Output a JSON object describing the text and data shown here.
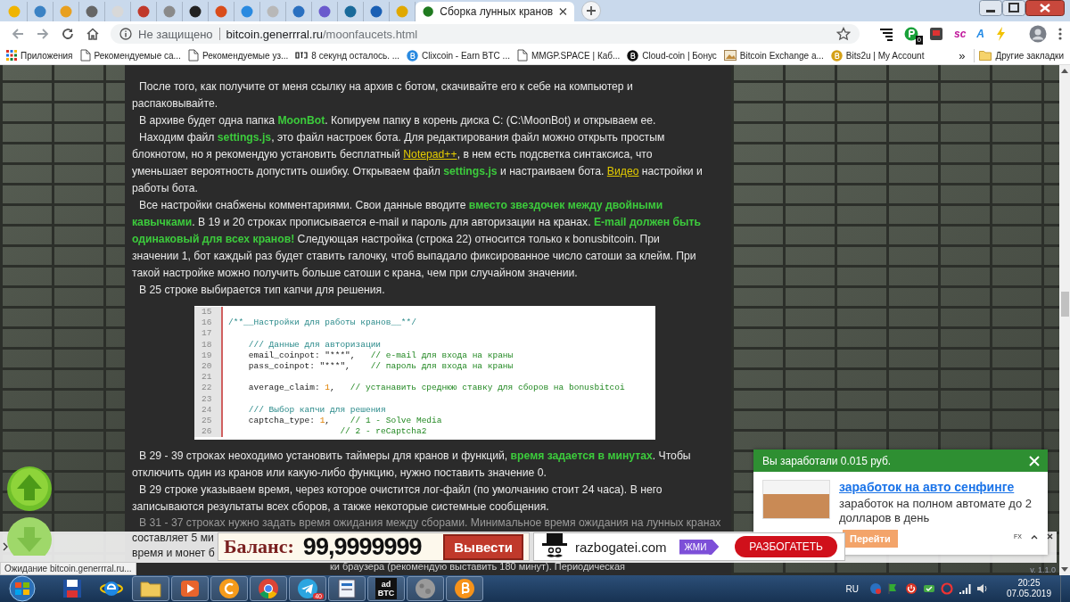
{
  "browser": {
    "tabs": [
      {
        "kind": "favicon",
        "color": "#f0b400",
        "selected": false
      },
      {
        "kind": "favicon",
        "color": "#3b82c4",
        "selected": false
      },
      {
        "kind": "favicon",
        "color": "#e8a020",
        "selected": false
      },
      {
        "kind": "favicon",
        "color": "#666666",
        "selected": false
      },
      {
        "kind": "favicon",
        "color": "#d8d8d8",
        "selected": false
      },
      {
        "kind": "favicon",
        "color": "#c0392b",
        "selected": false
      },
      {
        "kind": "favicon",
        "color": "#8a8a8a",
        "selected": false
      },
      {
        "kind": "favicon",
        "color": "#222222",
        "selected": false
      },
      {
        "kind": "favicon",
        "color": "#d94c1a",
        "selected": false
      },
      {
        "kind": "favicon",
        "color": "#2a8ae0",
        "selected": false
      },
      {
        "kind": "favicon",
        "color": "#b8b8b8",
        "selected": false
      },
      {
        "kind": "favicon",
        "color": "#2a70c0",
        "selected": false
      },
      {
        "kind": "favicon",
        "color": "#6a5acd",
        "selected": false
      },
      {
        "kind": "favicon",
        "color": "#1a6a9a",
        "selected": false
      },
      {
        "kind": "favicon",
        "color": "#1a5fb4",
        "selected": false
      },
      {
        "kind": "favicon",
        "color": "#e0a800",
        "selected": false
      },
      {
        "kind": "page",
        "title": "Сборка лунных кранов",
        "color": "#1f7a1f",
        "selected": true
      }
    ],
    "address": {
      "security": "Не защищено",
      "domain": "bitcoin.generrral.ru",
      "path": "/moonfaucets.html"
    },
    "extensions": [
      {
        "kind": "lines"
      },
      {
        "kind": "badge",
        "badge": "0"
      },
      {
        "kind": "box"
      },
      {
        "kind": "text",
        "label": "sc",
        "color": "#c0179b"
      },
      {
        "kind": "text",
        "label": "A",
        "color": "#1e88e5"
      },
      {
        "kind": "bolt"
      }
    ],
    "bookmarks": [
      {
        "kind": "apps",
        "label": "Приложения"
      },
      {
        "kind": "page",
        "label": "Рекомендуемые са..."
      },
      {
        "kind": "page",
        "label": "Рекомендуемые уз..."
      },
      {
        "kind": "btc",
        "label": "8 секунд осталось. ..."
      },
      {
        "kind": "coin",
        "color": "#2a8ae0",
        "label": "Clixcoin - Earn BTC ..."
      },
      {
        "kind": "page",
        "label": "MMGP.SPACE | Каб..."
      },
      {
        "kind": "coin",
        "color": "#111111",
        "label": "Cloud-coin | Бонус"
      },
      {
        "kind": "image",
        "label": "Bitcoin Exchange a..."
      },
      {
        "kind": "coin",
        "color": "#d4a017",
        "label": "Bits2u | My Account"
      }
    ],
    "bookmarks_more": "»",
    "other_bookmarks": "Другие закладки"
  },
  "article": {
    "paragraphs": [
      {
        "parts": [
          {
            "kind": "text",
            "text": "После того, как получите от меня ссылку на архив с ботом, скачивайте его к себе на компьютер и распаковывайте."
          }
        ]
      },
      {
        "parts": [
          {
            "kind": "text",
            "text": "В архиве будет одна папка **MoonBot**. Копируем папку в корень диска C: (C:\\MoonBot) и открываем ее."
          }
        ]
      },
      {
        "parts": [
          {
            "kind": "text",
            "text": "Находим файл **settings.js**, это файл настроек бота. Для редактирования файл можно открыть простым блокнотом, но я рекомендую установить бесплатный "
          },
          {
            "kind": "link",
            "text": "Notepad++"
          },
          {
            "kind": "text",
            "text": ", в нем есть подсветка синтаксиса, что уменьшает вероятность допустить ошибку. Открываем файл **settings.js** и настраиваем бота. "
          },
          {
            "kind": "link",
            "text": "Видео"
          },
          {
            "kind": "text",
            "text": " настройки и работы бота."
          }
        ]
      },
      {
        "parts": [
          {
            "kind": "text",
            "text": "Все настройки снабжены комментариями. Свои данные вводите **вместо звездочек между двойными кавычками**. В 19 и 20 строках прописывается e-mail и пароль для авторизации на кранах. **E-mail должен быть одинаковый для всех кранов!** Следующая настройка (строка 22) относится только к bonusbitcoin. При значении 1, бот каждый раз будет ставить галочку, чтоб выпадало фиксированное число сатоши за клейм. При такой настройке можно получить больше сатоши с крана, чем при случайном значении."
          }
        ]
      },
      {
        "parts": [
          {
            "kind": "text",
            "text": "В 25 строке выбирается тип капчи для решения."
          }
        ]
      }
    ],
    "code": [
      {
        "num": "15"
      },
      {
        "num": "16",
        "parts": [
          {
            "kind": "doc",
            "text": "/**__Настройки для работы кранов__**/"
          }
        ]
      },
      {
        "num": "17"
      },
      {
        "num": "18",
        "parts": [
          {
            "kind": "doc",
            "text": "    /// Данные для авторизации"
          }
        ]
      },
      {
        "num": "19",
        "parts": [
          {
            "kind": "code",
            "text": "    email_coinpot: \"***\","
          },
          {
            "kind": "comment",
            "text": "   // e-mail для входа на краны"
          }
        ]
      },
      {
        "num": "20",
        "parts": [
          {
            "kind": "code",
            "text": "    pass_coinpot: \"***\","
          },
          {
            "kind": "comment",
            "text": "    // пароль для входа на краны"
          }
        ]
      },
      {
        "num": "21"
      },
      {
        "num": "22",
        "parts": [
          {
            "kind": "code",
            "text": "    average_claim: "
          },
          {
            "kind": "number",
            "text": "1"
          },
          {
            "kind": "code",
            "text": ","
          },
          {
            "kind": "comment",
            "text": "   // устанавить среднюю ставку для сборов на bonusbitcoi"
          }
        ]
      },
      {
        "num": "23"
      },
      {
        "num": "24",
        "parts": [
          {
            "kind": "doc",
            "text": "    /// Выбор капчи для решения"
          }
        ]
      },
      {
        "num": "25",
        "parts": [
          {
            "kind": "code",
            "text": "    captcha_type: "
          },
          {
            "kind": "number",
            "text": "1"
          },
          {
            "kind": "code",
            "text": ","
          },
          {
            "kind": "comment",
            "text": "    // 1 - Solve Media"
          }
        ]
      },
      {
        "num": "26",
        "parts": [
          {
            "kind": "comment",
            "text": "                      // 2 - reCaptcha2"
          }
        ]
      }
    ],
    "paragraphs_after": [
      {
        "parts": [
          {
            "kind": "text",
            "text": "В 29 - 39 строках неоходимо установить таймеры для кранов и функций, **время задается в минутах**. Чтобы отключить один из кранов или какую-либо функцию, нужно поставить значение 0."
          }
        ]
      },
      {
        "parts": [
          {
            "kind": "text",
            "text": "В 29 строке указываем время, через которое очистится лог-файл (по умолчанию стоит 24 часа). В него записываются результаты всех сборов, а также некоторые системные сообщения."
          }
        ]
      }
    ],
    "cut_lines": [
      {
        "kind": "faded",
        "text": "В 31 - 37 строках нужно задать время ожидания между сборами. Минимальное время ожидания на лунных кранах"
      },
      {
        "kind": "plain",
        "text": "составляет 5 ми"
      },
      {
        "kind": "plain",
        "text": "время и монет б"
      },
      {
        "kind": "tail",
        "text": "ки браузера (рекомендую выставить 180 минут). Периодическая"
      }
    ]
  },
  "ad_bar": {
    "balance_label": "Баланс:",
    "balance": "99,9999999",
    "withdraw": "Вывести",
    "site": "razbogatei.com",
    "press": "ЖМИ",
    "cta": "РАЗБОГАТЕТЬ",
    "fx": "FX"
  },
  "notification": {
    "title": "Вы заработали 0.015 руб.",
    "link": "заработок на авто сенфинге",
    "text": "заработок на полном автомате до 2 долларов в день",
    "button": "Перейти"
  },
  "status_text": "Ожидание bitcoin.generrral.ru...",
  "version": "v. 1.1.0",
  "taskbar": {
    "items": [
      {
        "kind": "disk",
        "running": false
      },
      {
        "kind": "ie",
        "running": false
      },
      {
        "kind": "folder",
        "running": true
      },
      {
        "kind": "media",
        "running": true
      },
      {
        "kind": "ccoin",
        "running": true
      },
      {
        "kind": "chrome",
        "running": true
      },
      {
        "kind": "telegram",
        "running": true,
        "badge": "40"
      },
      {
        "kind": "app",
        "running": true
      },
      {
        "kind": "adbtc",
        "running": true,
        "label": "ad BTC"
      },
      {
        "kind": "moon",
        "running": true
      },
      {
        "kind": "bitcoin",
        "running": true
      }
    ],
    "language": "RU",
    "time": "20:25",
    "date": "07.05.2019"
  }
}
